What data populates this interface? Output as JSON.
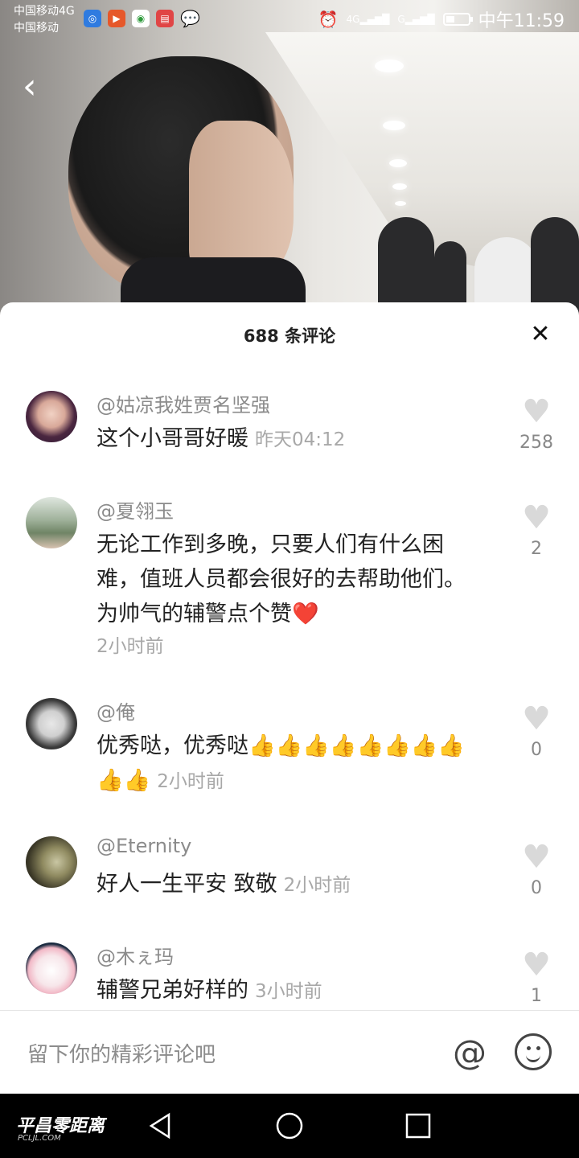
{
  "status_bar": {
    "carrier_line1": "中国移动4G",
    "carrier_line2": "中国移动",
    "network1": "4G",
    "network2": "G",
    "time": "中午11:59"
  },
  "header": {
    "comment_count_title": "688 条评论",
    "close_icon": "close-icon"
  },
  "comments": [
    {
      "user": "@姑凉我姓贾名坚强",
      "text": "这个小哥哥好暖",
      "time": "昨天04:12",
      "likes": "258"
    },
    {
      "user": "@夏翎玉",
      "text": "无论工作到多晚，只要人们有什么困难，值班人员都会很好的去帮助他们。为帅气的辅警点个赞❤️",
      "time": "2小时前",
      "likes": "2"
    },
    {
      "user": "@俺",
      "text": "优秀哒，优秀哒👍👍👍👍👍👍👍👍👍👍",
      "time": "2小时前",
      "likes": "0"
    },
    {
      "user": "@Eternity",
      "text": "好人一生平安 致敬",
      "time": "2小时前",
      "likes": "0"
    },
    {
      "user": "@木ぇ玛",
      "text": "辅警兄弟好样的",
      "time": "3小时前",
      "likes": "1"
    }
  ],
  "input_bar": {
    "placeholder": "留下你的精彩评论吧",
    "at_symbol": "@"
  },
  "watermark": {
    "main": "平昌零距离",
    "sub": "PCLJL.COM"
  },
  "colors": {
    "sheet_bg": "#ffffff",
    "heart_inactive": "#d9d9d9",
    "secondary_text": "#8b8b8b"
  }
}
